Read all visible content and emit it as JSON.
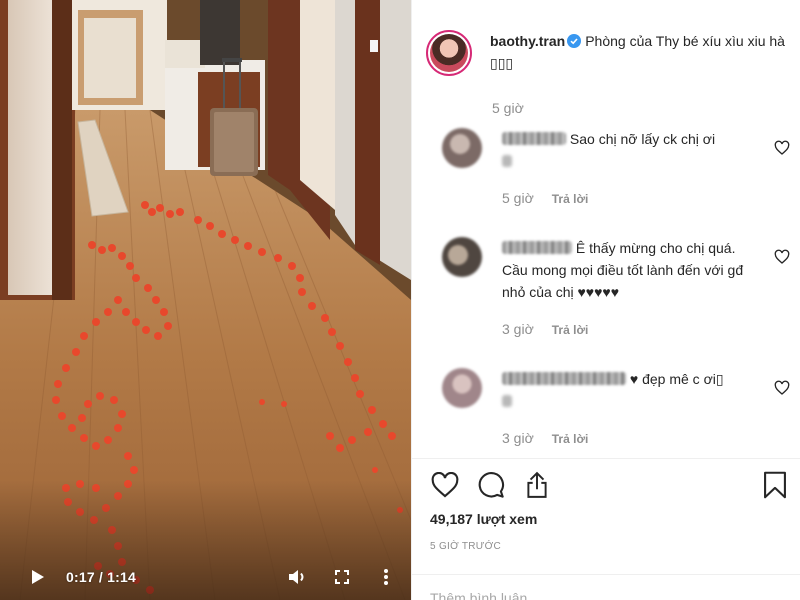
{
  "video": {
    "current_time": "0:17",
    "duration": "1:14",
    "time_separator": " / "
  },
  "post": {
    "username": "baothy.tran",
    "caption": "Phòng của Thy bé xíu xìu xiu hà ▯▯▯",
    "time_ago": "5 giờ"
  },
  "comments": [
    {
      "text": "Sao chị nỡ lấy ck chị ơi",
      "time_ago": "5 giờ",
      "reply_label": "Trả lời"
    },
    {
      "text": "Ê thấy mừng cho chị quá. Cầu mong mọi điều tốt lành đến với gđ nhỏ của chị ♥♥♥♥♥",
      "time_ago": "3 giờ",
      "reply_label": "Trả lời"
    },
    {
      "text": "♥ đẹp mê c ơi▯",
      "time_ago": "3 giờ",
      "reply_label": "Trả lời"
    }
  ],
  "stats": {
    "views": "49,187 lượt xem",
    "posted": "5 GIỜ TRƯỚC"
  },
  "add_comment": {
    "placeholder": "Thêm bình luận..."
  },
  "colors": {
    "verified": "#3897f0",
    "text": "#262626",
    "muted": "#8e8e8e",
    "floor": "#b07a48",
    "petal": "#e8482c"
  },
  "icons": {
    "play": "play-icon",
    "volume": "volume-icon",
    "fullscreen": "fullscreen-icon",
    "more": "more-vertical-icon",
    "like": "heart-icon",
    "comment": "comment-icon",
    "share": "share-icon",
    "save": "bookmark-icon"
  }
}
